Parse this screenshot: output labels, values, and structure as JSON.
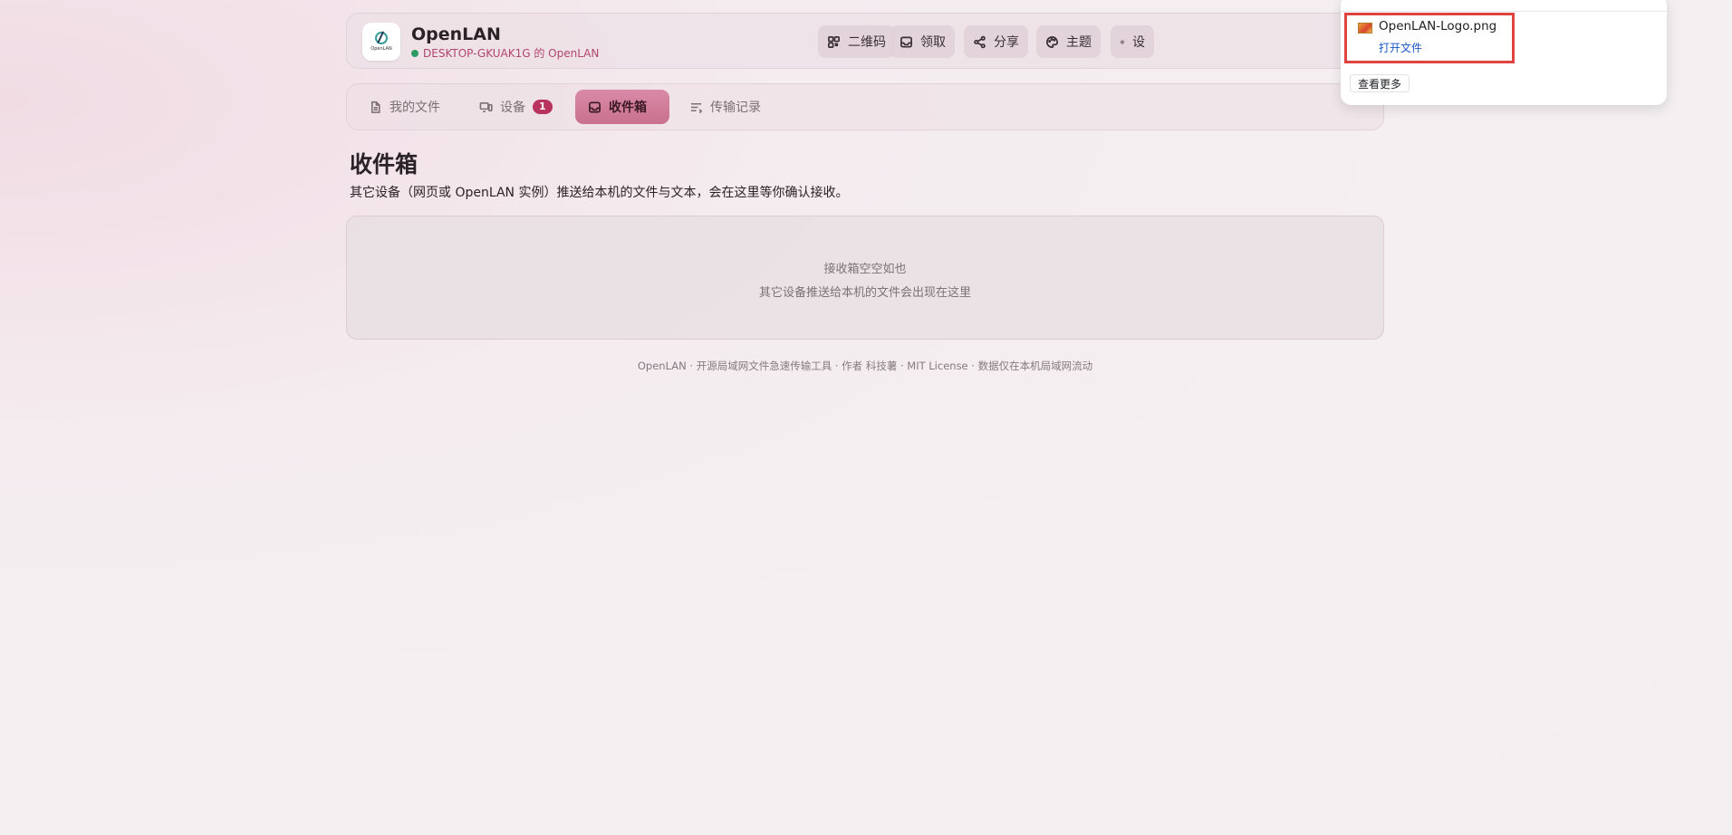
{
  "header": {
    "app_name": "OpenLAN",
    "logo_text": "OpenLAN",
    "status_text": "DESKTOP-GKUAK1G 的 OpenLAN",
    "status_color": "#2e9a63",
    "buttons": [
      {
        "label": "二维码",
        "icon": "qrcode-icon"
      },
      {
        "label": "领取",
        "icon": "inbox-icon"
      },
      {
        "label": "分享",
        "icon": "share-icon"
      },
      {
        "label": "主题",
        "icon": "palette-icon"
      },
      {
        "label": "设",
        "icon": "gear-icon"
      }
    ]
  },
  "tabs": [
    {
      "label": "我的文件",
      "icon": "file-icon",
      "active": false
    },
    {
      "label": "设备",
      "icon": "devices-icon",
      "active": false,
      "badge": "1"
    },
    {
      "label": "收件箱",
      "icon": "inbox-icon",
      "active": true
    },
    {
      "label": "传输记录",
      "icon": "list-icon",
      "active": false
    }
  ],
  "main": {
    "title": "收件箱",
    "description": "其它设备（网页或 OpenLAN 实例）推送给本机的文件与文本，会在这里等你确认接收。",
    "empty_title": "接收箱空空如也",
    "empty_subtitle": "其它设备推送给本机的文件会出现在这里"
  },
  "footer": {
    "text": "OpenLAN · 开源局域网文件急速传输工具 · 作者 科技薯 · MIT License · 数据仅在本机局域网流动"
  },
  "download_popup": {
    "file_name": "OpenLAN-Logo.png",
    "open_label": "打开文件",
    "more_label": "查看更多"
  },
  "colors": {
    "accent": "#c9718f",
    "badge": "#b8335d",
    "status_text": "#b2456e",
    "link": "#1a56c4",
    "highlight": "#e0443e"
  }
}
